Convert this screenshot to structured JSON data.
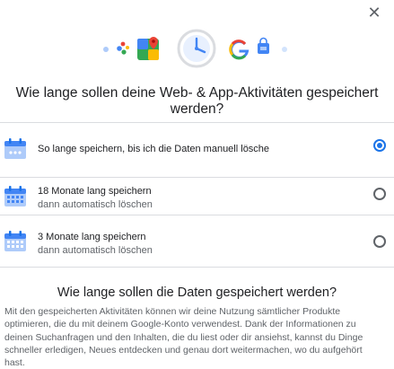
{
  "dialog": {
    "title": "Wie lange sollen deine Web- & App-Aktivitäten gespeichert werden?",
    "options": [
      {
        "main": "So lange speichern, bis ich die Daten manuell lösche",
        "sub": "",
        "selected": true,
        "icon": "calendar-infinite-icon"
      },
      {
        "main": "18 Monate lang speichern",
        "sub": "dann automatisch löschen",
        "selected": false,
        "icon": "calendar-18-months-icon"
      },
      {
        "main": "3 Monate lang speichern",
        "sub": "dann automatisch löschen",
        "selected": false,
        "icon": "calendar-3-months-icon"
      }
    ],
    "subtitle": "Wie lange sollen die Daten gespeichert werden?",
    "description": "Mit den gespeicherten Aktivitäten können wir deine Nutzung sämtlicher Produkte optimieren, die du mit deinem Google-Konto verwendest. Dank der Informationen zu deinen Suchanfragen und den Inhalten, die du liest oder dir ansiehst, kannst du Dinge schneller erledigen, Neues entdecken und genau dort weitermachen, wo du aufgehört hast."
  },
  "close": {
    "icon": "close-icon",
    "glyph": "✕"
  },
  "hero": {
    "icons": [
      "dot-icon",
      "assistant-dots-icon",
      "maps-pin-icon",
      "clock-icon",
      "google-g-icon",
      "shopping-bag-icon",
      "dot-icon"
    ]
  },
  "colors": {
    "accent": "#1a73e8",
    "text": "#202124",
    "muted": "#5f6368",
    "divider": "#dadce0"
  }
}
